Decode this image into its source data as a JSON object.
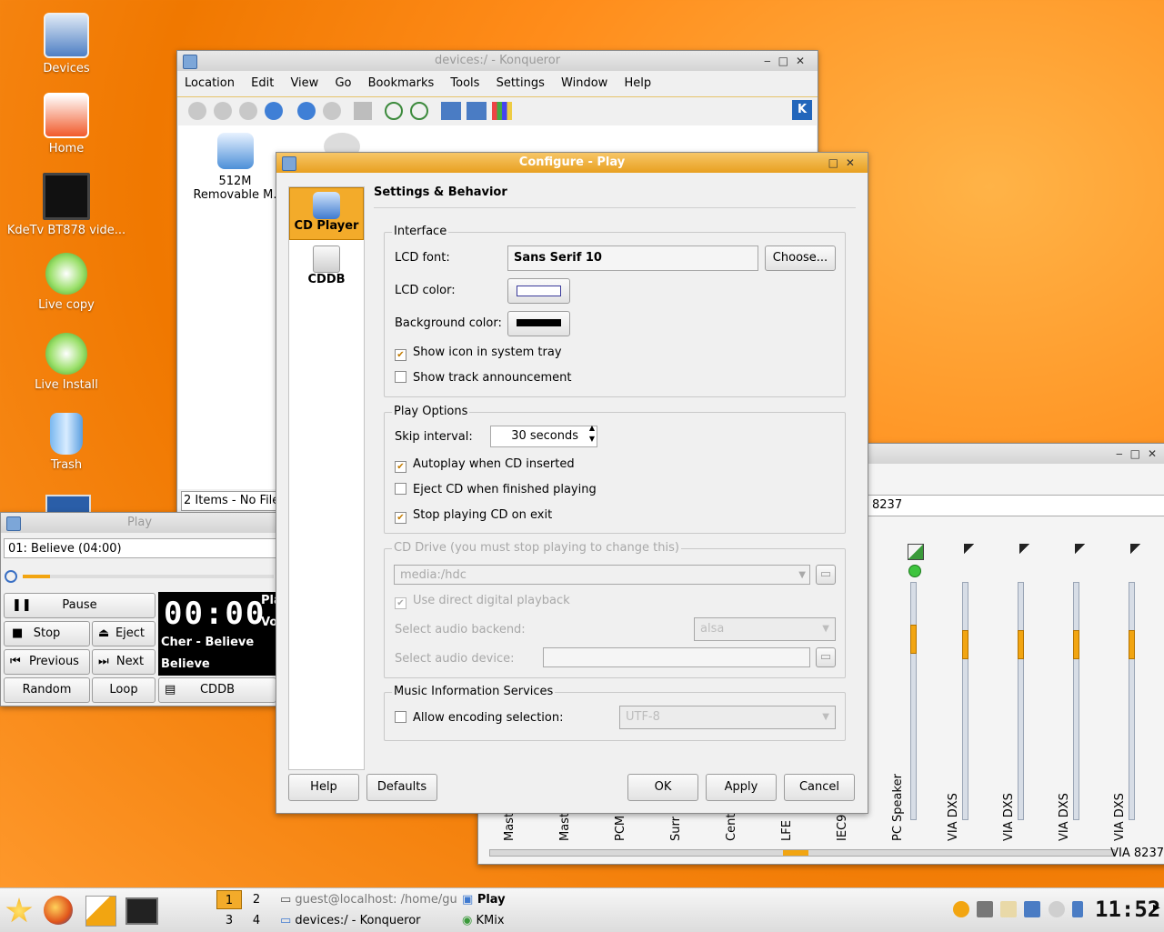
{
  "desktop": {
    "icons": [
      {
        "label": "Devices"
      },
      {
        "label": "Home"
      },
      {
        "label": "KdeTv BT878 vide..."
      },
      {
        "label": "Live copy"
      },
      {
        "label": "Live Install"
      },
      {
        "label": "Trash"
      }
    ]
  },
  "konqueror": {
    "title": "devices:/ - Konqueror",
    "menu": [
      "Location",
      "Edit",
      "View",
      "Go",
      "Bookmarks",
      "Tools",
      "Settings",
      "Window",
      "Help"
    ],
    "items": [
      {
        "label": "512M\nRemovable M."
      }
    ],
    "status": "2 Items - No File"
  },
  "player": {
    "title": "Play",
    "track": "01: Believe (04:00)",
    "buttons": {
      "pause": "Pause",
      "stop": "Stop",
      "eject": "Eject",
      "previous": "Previous",
      "next": "Next",
      "random": "Random",
      "loop": "Loop",
      "cddb": "CDDB"
    },
    "lcd_time": "00:00",
    "lcd_side": [
      "Pla",
      "Vo"
    ],
    "artist_line": "Cher - Believe",
    "album_line": "Believe"
  },
  "kmix": {
    "device_label": "8237",
    "device_footer": "VIA 8237",
    "channels": [
      "Mast",
      "Mast",
      "PCM",
      "Surr",
      "Cent",
      "LFE",
      "IEC9",
      "PC Speaker",
      "VIA DXS",
      "VIA DXS",
      "VIA DXS",
      "VIA DXS"
    ]
  },
  "dialog": {
    "title": "Configure - Play",
    "sidebar": [
      {
        "label": "CD Player"
      },
      {
        "label": "CDDB"
      }
    ],
    "heading": "Settings & Behavior",
    "interface": {
      "title": "Interface",
      "lcd_font_label": "LCD font:",
      "lcd_font_value": "Sans Serif 10",
      "choose_label": "Choose...",
      "lcd_color_label": "LCD color:",
      "background_color_label": "Background color:",
      "show_tray": "Show icon in system tray",
      "show_announce": "Show track announcement"
    },
    "play_options": {
      "title": "Play Options",
      "skip_label": "Skip interval:",
      "skip_value": "30 seconds",
      "autoplay": "Autoplay when CD inserted",
      "eject_finished": "Eject CD when finished playing",
      "stop_exit": "Stop playing CD on exit"
    },
    "cd_drive": {
      "title": "CD Drive (you must stop playing to change this)",
      "device": "media:/hdc",
      "digital": "Use direct digital playback",
      "backend_label": "Select audio backend:",
      "backend_value": "alsa",
      "device_label": "Select audio device:"
    },
    "music_info": {
      "title": "Music Information Services",
      "encoding_label": "Allow encoding selection:",
      "encoding_value": "UTF-8"
    },
    "buttons": {
      "help": "Help",
      "defaults": "Defaults",
      "ok": "OK",
      "apply": "Apply",
      "cancel": "Cancel"
    }
  },
  "taskbar": {
    "pager": [
      "1",
      "2",
      "3",
      "4"
    ],
    "tasks": [
      {
        "label": "guest@localhost: /home/gu"
      },
      {
        "label": "Play"
      },
      {
        "label": "devices:/ - Konqueror"
      },
      {
        "label": "KMix"
      }
    ],
    "clock": "11:52"
  }
}
